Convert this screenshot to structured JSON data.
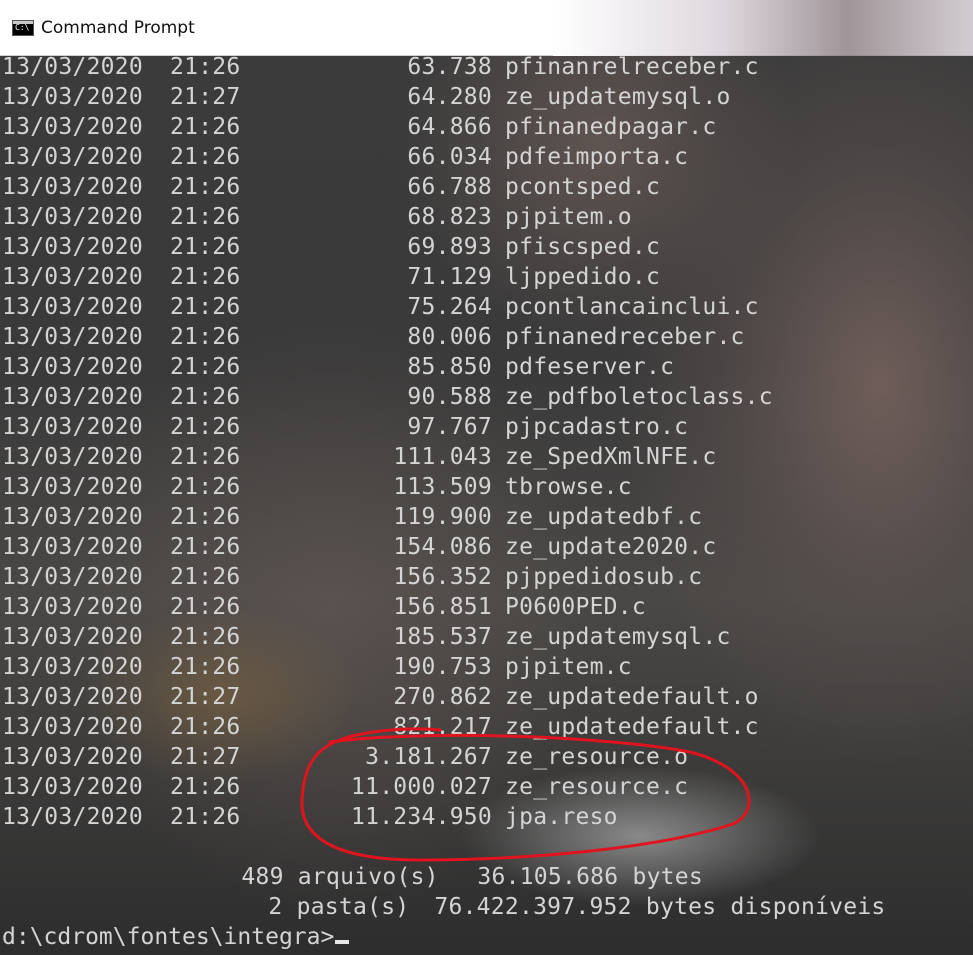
{
  "window": {
    "title": "Command Prompt",
    "icon": "console-app-icon",
    "icon_text": "C:\\"
  },
  "listing": [
    {
      "date": "13/03/2020",
      "time": "21:26",
      "size": "63.738",
      "name": "pfinanrelreceber.c"
    },
    {
      "date": "13/03/2020",
      "time": "21:27",
      "size": "64.280",
      "name": "ze_updatemysql.o"
    },
    {
      "date": "13/03/2020",
      "time": "21:26",
      "size": "64.866",
      "name": "pfinanedpagar.c"
    },
    {
      "date": "13/03/2020",
      "time": "21:26",
      "size": "66.034",
      "name": "pdfeimporta.c"
    },
    {
      "date": "13/03/2020",
      "time": "21:26",
      "size": "66.788",
      "name": "pcontsped.c"
    },
    {
      "date": "13/03/2020",
      "time": "21:26",
      "size": "68.823",
      "name": "pjpitem.o"
    },
    {
      "date": "13/03/2020",
      "time": "21:26",
      "size": "69.893",
      "name": "pfiscsped.c"
    },
    {
      "date": "13/03/2020",
      "time": "21:26",
      "size": "71.129",
      "name": "ljppedido.c"
    },
    {
      "date": "13/03/2020",
      "time": "21:26",
      "size": "75.264",
      "name": "pcontlancainclui.c"
    },
    {
      "date": "13/03/2020",
      "time": "21:26",
      "size": "80.006",
      "name": "pfinanedreceber.c"
    },
    {
      "date": "13/03/2020",
      "time": "21:26",
      "size": "85.850",
      "name": "pdfeserver.c"
    },
    {
      "date": "13/03/2020",
      "time": "21:26",
      "size": "90.588",
      "name": "ze_pdfboletoclass.c"
    },
    {
      "date": "13/03/2020",
      "time": "21:26",
      "size": "97.767",
      "name": "pjpcadastro.c"
    },
    {
      "date": "13/03/2020",
      "time": "21:26",
      "size": "111.043",
      "name": "ze_SpedXmlNFE.c"
    },
    {
      "date": "13/03/2020",
      "time": "21:26",
      "size": "113.509",
      "name": "tbrowse.c"
    },
    {
      "date": "13/03/2020",
      "time": "21:26",
      "size": "119.900",
      "name": "ze_updatedbf.c"
    },
    {
      "date": "13/03/2020",
      "time": "21:26",
      "size": "154.086",
      "name": "ze_update2020.c"
    },
    {
      "date": "13/03/2020",
      "time": "21:26",
      "size": "156.352",
      "name": "pjppedidosub.c"
    },
    {
      "date": "13/03/2020",
      "time": "21:26",
      "size": "156.851",
      "name": "P0600PED.c"
    },
    {
      "date": "13/03/2020",
      "time": "21:26",
      "size": "185.537",
      "name": "ze_updatemysql.c"
    },
    {
      "date": "13/03/2020",
      "time": "21:26",
      "size": "190.753",
      "name": "pjpitem.c"
    },
    {
      "date": "13/03/2020",
      "time": "21:27",
      "size": "270.862",
      "name": "ze_updatedefault.o"
    },
    {
      "date": "13/03/2020",
      "time": "21:26",
      "size": "821.217",
      "name": "ze_updatedefault.c"
    },
    {
      "date": "13/03/2020",
      "time": "21:27",
      "size": "3.181.267",
      "name": "ze_resource.o"
    },
    {
      "date": "13/03/2020",
      "time": "21:26",
      "size": "11.000.027",
      "name": "ze_resource.c"
    },
    {
      "date": "13/03/2020",
      "time": "21:26",
      "size": "11.234.950",
      "name": "jpa.reso"
    }
  ],
  "summary": {
    "files_count": "489",
    "files_label": "arquivo(s)",
    "files_bytes": "36.105.686",
    "files_unit": "bytes",
    "dirs_count": "2",
    "dirs_label": "pasta(s)",
    "free_bytes": "76.422.397.952",
    "free_unit": "bytes disponíveis"
  },
  "prompt": {
    "path": "d:\\cdrom\\fontes\\integra>"
  },
  "colors": {
    "console_text": "#d4d4d4",
    "annotation": "#e0141e",
    "titlebar_bg": "#ffffff"
  }
}
